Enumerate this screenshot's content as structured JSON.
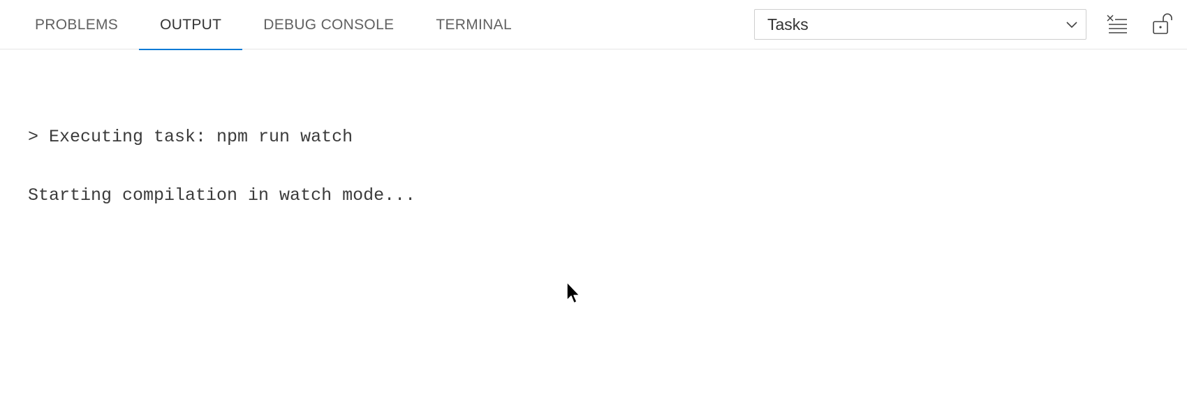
{
  "panel": {
    "tabs": [
      {
        "label": "PROBLEMS",
        "active": false
      },
      {
        "label": "OUTPUT",
        "active": true
      },
      {
        "label": "DEBUG CONSOLE",
        "active": false
      },
      {
        "label": "TERMINAL",
        "active": false
      }
    ],
    "channel_select": {
      "selected": "Tasks"
    },
    "actions": {
      "clear_icon": "clear-output-icon",
      "lock_icon": "unlock-scroll-icon"
    }
  },
  "output": {
    "lines": [
      "> Executing task: npm run watch",
      "Starting compilation in watch mode..."
    ]
  },
  "colors": {
    "active_tab_underline": "#0a7ad6",
    "tab_text": "#616161",
    "active_tab_text": "#333333"
  }
}
